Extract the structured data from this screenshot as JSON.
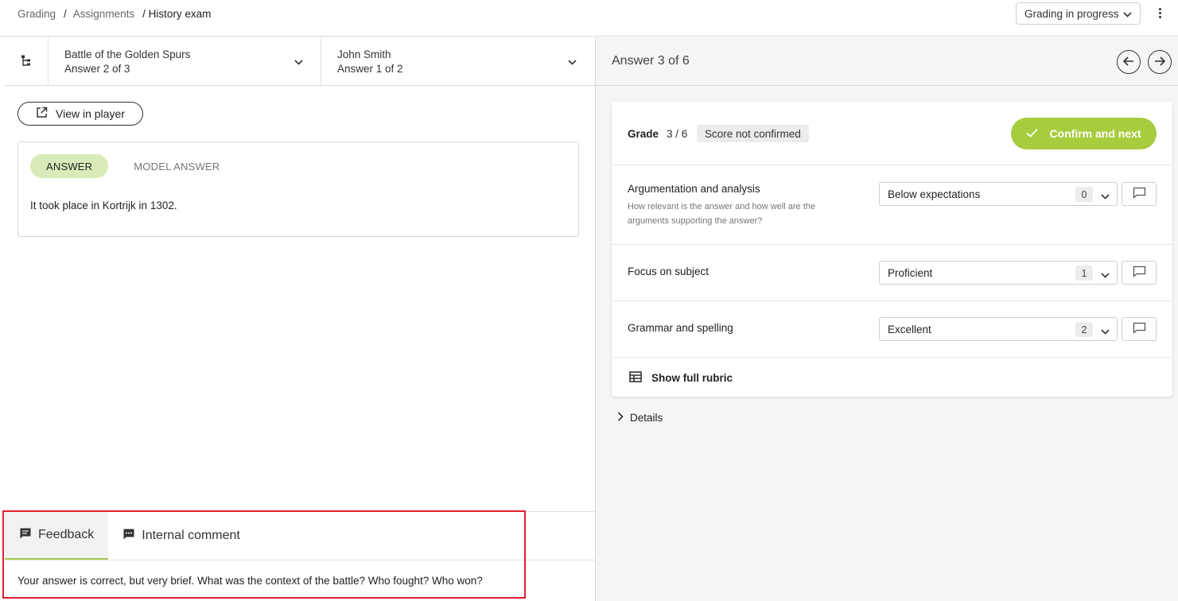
{
  "breadcrumb": {
    "grading": "Grading",
    "sep1": "/",
    "assignments": "Assignments",
    "current": "/ History exam"
  },
  "header": {
    "status": "Grading in progress"
  },
  "navigator": {
    "question_title": "Battle of the Golden Spurs",
    "question_sub": "Answer 2 of 3",
    "student_name": "John Smith",
    "student_sub": "Answer 1 of 2"
  },
  "left": {
    "view_in_player": "View in player",
    "tabs": {
      "answer": "ANSWER",
      "model_answer": "MODEL ANSWER"
    },
    "answer_text": "It took place in Kortrijk in 1302."
  },
  "feedback": {
    "tab_feedback": "Feedback",
    "tab_internal": "Internal comment",
    "text": "Your answer is correct, but very brief. What was the context of the battle? Who fought? Who won?"
  },
  "right": {
    "answer_count": "Answer 3 of 6",
    "grade_label": "Grade",
    "grade_score": "3 / 6",
    "score_status": "Score not confirmed",
    "confirm_label": "Confirm and next",
    "criteria": [
      {
        "title": "Argumentation and analysis",
        "description": "How relevant is the answer and how well are the arguments supporting the answer?",
        "level": "Below expectations",
        "points": "0"
      },
      {
        "title": "Focus on subject",
        "description": "",
        "level": "Proficient",
        "points": "1"
      },
      {
        "title": "Grammar and spelling",
        "description": "",
        "level": "Excellent",
        "points": "2"
      }
    ],
    "show_rubric": "Show full rubric",
    "details": "Details"
  },
  "colors": {
    "accent_green": "#a7cc3e",
    "pill_green": "#d9ebb8",
    "highlight_red": "#e0202e"
  }
}
